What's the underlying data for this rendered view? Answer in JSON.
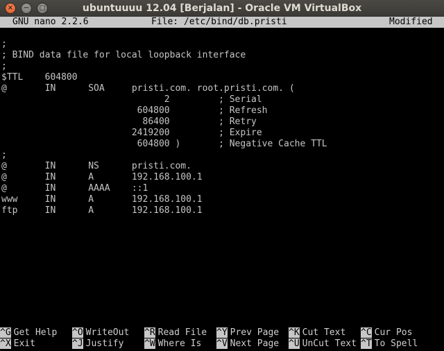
{
  "window": {
    "title": "ubuntuuuu 12.04 [Berjalan] - Oracle VM VirtualBox",
    "close_glyph": "×",
    "minimize_glyph": "−",
    "maximize_glyph": "□"
  },
  "nano": {
    "version": "GNU nano 2.2.6",
    "file": "File: /etc/bind/db.pristi",
    "status": "Modified"
  },
  "file_lines": [
    ";",
    "; BIND data file for local loopback interface",
    ";",
    "$TTL    604800",
    "@       IN      SOA     pristi.com. root.pristi.com. (",
    "                              2         ; Serial",
    "                         604800         ; Refresh",
    "                          86400         ; Retry",
    "                        2419200         ; Expire",
    "                         604800 )       ; Negative Cache TTL",
    ";",
    "@       IN      NS      pristi.com.",
    "@       IN      A       192.168.100.1",
    "@       IN      AAAA    ::1",
    "www     IN      A       192.168.100.1",
    "ftp     IN      A       192.168.100.1"
  ],
  "shortcuts": [
    [
      {
        "key": "^G",
        "label": "Get Help"
      },
      {
        "key": "^O",
        "label": "WriteOut"
      },
      {
        "key": "^R",
        "label": "Read File"
      },
      {
        "key": "^Y",
        "label": "Prev Page"
      },
      {
        "key": "^K",
        "label": "Cut Text"
      },
      {
        "key": "^C",
        "label": "Cur Pos"
      }
    ],
    [
      {
        "key": "^X",
        "label": "Exit"
      },
      {
        "key": "^J",
        "label": "Justify"
      },
      {
        "key": "^W",
        "label": "Where Is"
      },
      {
        "key": "^V",
        "label": "Next Page"
      },
      {
        "key": "^U",
        "label": "UnCut Text"
      },
      {
        "key": "^T",
        "label": "To Spell"
      }
    ]
  ]
}
